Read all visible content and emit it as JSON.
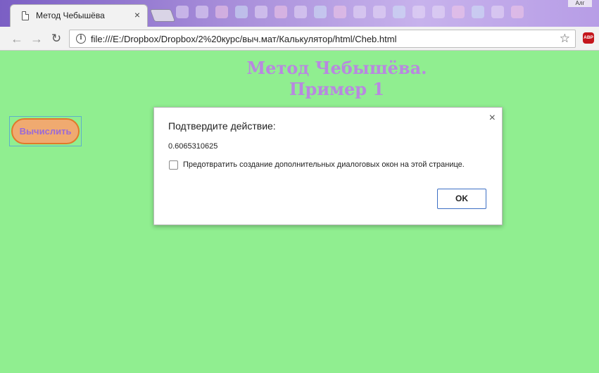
{
  "browser": {
    "tab_title": "Метод Чебышёва",
    "tab_close": "×",
    "url": "file:///E:/Dropbox/Dropbox/2%20курс/выч.мат/Калькулятор/html/Cheb.html",
    "back_icon": "←",
    "forward_icon": "→",
    "reload_icon": "↻",
    "star_icon": "☆",
    "abp_label": "ABP",
    "info_icon": "i",
    "user_label": "Алг"
  },
  "page": {
    "heading_line1": "Метод Чебышёва.",
    "heading_line2": "Пример 1",
    "calc_button": "Вычислить",
    "background_color": "#90ee90",
    "heading_color": "#b888e0"
  },
  "dialog": {
    "title": "Подтвердите действие:",
    "message": "0.6065310625",
    "checkbox_label": "Предотвратить создание дополнительных диалоговых окон на этой странице.",
    "checkbox_checked": false,
    "ok_button": "OK",
    "close_icon": "×"
  }
}
